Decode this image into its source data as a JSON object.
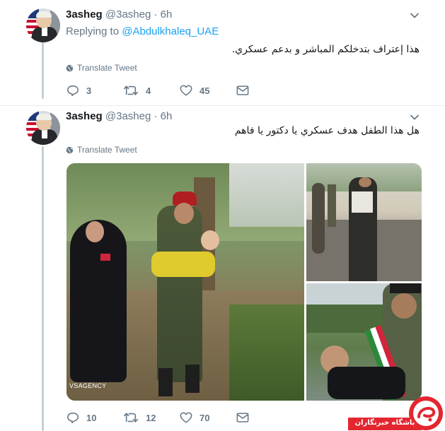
{
  "tweets": [
    {
      "name": "3asheg",
      "handle": "@3asheg",
      "time": "6h",
      "replying_prefix": "Replying to ",
      "replying_to": "@Abdulkhaleq_UAE",
      "text": "هذا إعتراف بتدخلكم المباشر و بدعم عسكري.",
      "translate": "Translate Tweet",
      "replies": "3",
      "retweets": "4",
      "likes": "45"
    },
    {
      "name": "3asheg",
      "handle": "@3asheg",
      "time": "6h",
      "text": "هل هذا الطفل هدف عسكري يا دكتور يا فاهم",
      "translate": "Translate Tweet",
      "replies": "10",
      "retweets": "12",
      "likes": "70",
      "media_watermark": "VSAGENCY"
    }
  ],
  "icons": [
    "chevron-down-icon",
    "globe-icon",
    "reply-icon",
    "retweet-icon",
    "like-icon",
    "dm-icon"
  ],
  "colors": {
    "link": "#1da1f2",
    "muted": "#657786",
    "thread": "#c4cfd6",
    "logo_red": "#e3262f"
  },
  "logo": {
    "text": "باشگاه خبرنگاران"
  }
}
